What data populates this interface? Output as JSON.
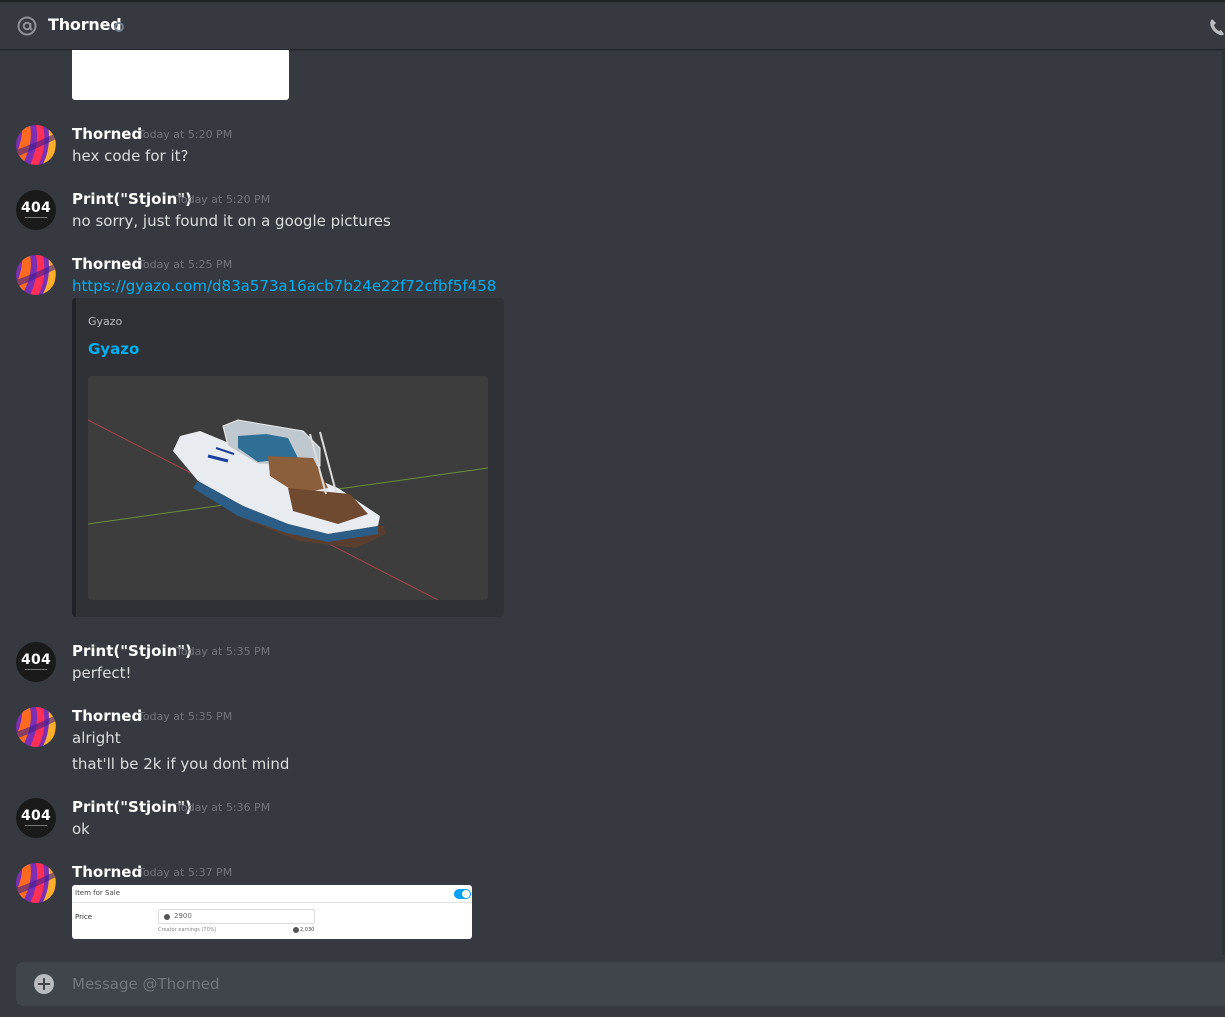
{
  "header": {
    "title": "Thorned"
  },
  "messages": [
    {
      "author": "Thorned",
      "avatar": "thorned",
      "time": "Today at 5:20 PM",
      "lines": [
        "hex code for it?"
      ]
    },
    {
      "author": "Print(\"Stjoin\")",
      "avatar": "404",
      "time": "Today at 5:20 PM",
      "lines": [
        "no sorry, just found it on a google pictures"
      ]
    },
    {
      "author": "Thorned",
      "avatar": "thorned",
      "time": "Today at 5:25 PM",
      "lines": [
        "https://gyazo.com/d83a573a16acb7b24e22f72cfbf5f458"
      ]
    },
    {
      "author": "Print(\"Stjoin\")",
      "avatar": "404",
      "time": "Today at 5:35 PM",
      "lines": [
        "perfect!"
      ]
    },
    {
      "author": "Thorned",
      "avatar": "thorned",
      "time": "Today at 5:35 PM",
      "lines": [
        "alright",
        "that'll be 2k if you dont mind"
      ]
    },
    {
      "author": "Print(\"Stjoin\")",
      "avatar": "404",
      "time": "Today at 5:36 PM",
      "lines": [
        "ok"
      ]
    },
    {
      "author": "Thorned",
      "avatar": "thorned",
      "time": "Today at 5:37 PM",
      "lines": []
    }
  ],
  "avatar404_text": "404",
  "embed": {
    "provider": "Gyazo",
    "title": "Gyazo",
    "accent": "#202225"
  },
  "sale_card": {
    "header": "Item for Sale",
    "price_label": "Price",
    "price_value": "2900",
    "creator_label": "Creator earnings (70%)",
    "creator_value": "2,030"
  },
  "composer": {
    "placeholder": "Message @Thorned"
  },
  "colors": {
    "background": "#36393f",
    "link": "#00b0f4",
    "timestamp": "#72767d"
  }
}
